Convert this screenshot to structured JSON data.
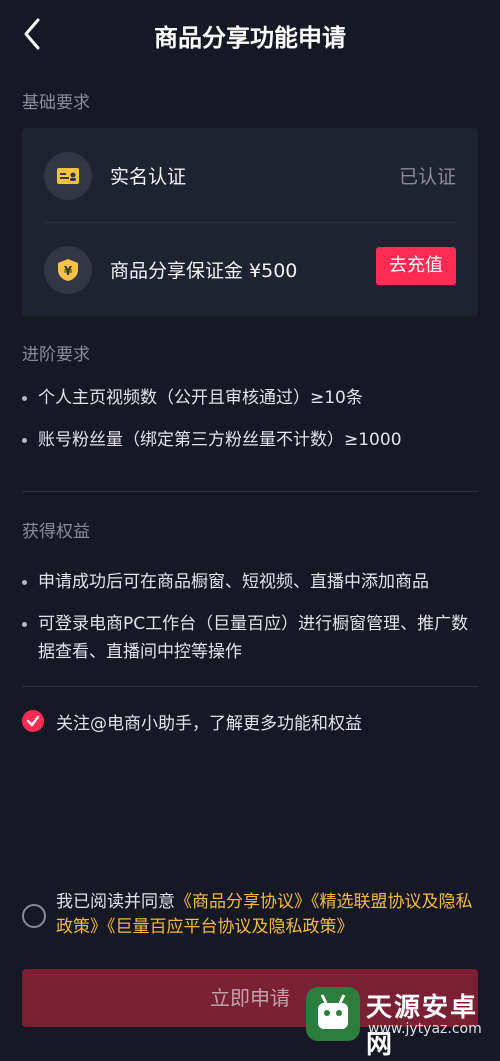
{
  "header": {
    "title": "商品分享功能申请"
  },
  "basic": {
    "title": "基础要求",
    "realname": {
      "label": "实名认证",
      "status": "已认证"
    },
    "deposit": {
      "label": "商品分享保证金 ¥500",
      "button": "去充值"
    }
  },
  "advanced": {
    "title": "进阶要求",
    "items": [
      "个人主页视频数（公开且审核通过）≥10条",
      "账号粉丝量（绑定第三方粉丝量不计数）≥1000"
    ]
  },
  "benefits": {
    "title": "获得权益",
    "items": [
      "申请成功后可在商品橱窗、短视频、直播中添加商品",
      "可登录电商PC工作台（巨量百应）进行橱窗管理、推广数据查看、直播间中控等操作"
    ]
  },
  "follow": {
    "label": "关注@电商小助手，了解更多功能和权益",
    "checked": true
  },
  "agreement": {
    "prefix": "我已阅读并同意",
    "link1": "《商品分享协议》",
    "link2": "《精选联盟协议及隐私政策》",
    "link3": "《巨量百应平台协议及隐私政策》",
    "checked": false
  },
  "submit": {
    "label": "立即申请"
  },
  "watermark": {
    "name": "天源安卓网",
    "url": "www.jytyaz.com"
  },
  "colors": {
    "accent": "#fe2c55",
    "link": "#f7b943",
    "background": "#161823"
  }
}
